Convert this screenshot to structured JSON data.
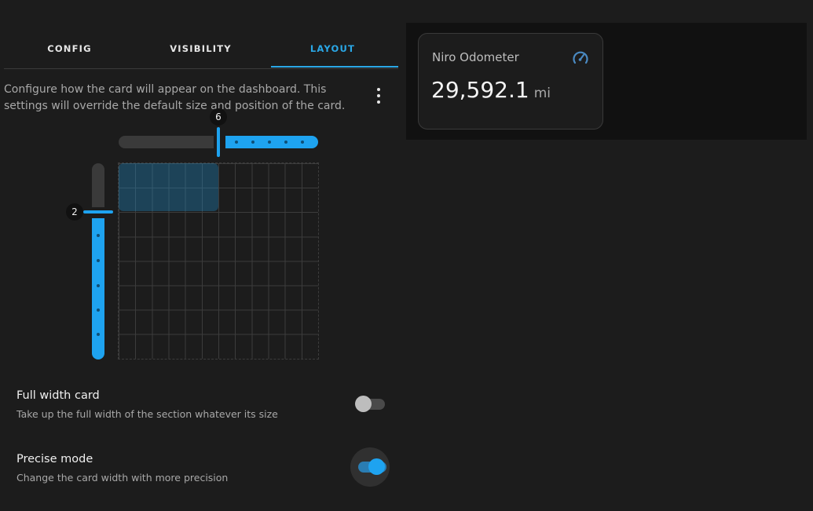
{
  "tabs": [
    {
      "label": "CONFIG",
      "active": false
    },
    {
      "label": "VISIBILITY",
      "active": false
    },
    {
      "label": "LAYOUT",
      "active": true
    }
  ],
  "description": "Configure how the card will appear on the dashboard. This settings will override the default size and position of the card.",
  "icons": {
    "menu": "dots-vertical-icon",
    "card": "speedometer-icon"
  },
  "layout_editor": {
    "columns_value": "6",
    "rows_value": "2",
    "grid_columns": 12,
    "grid_rows": 8
  },
  "options": {
    "full_width": {
      "title": "Full width card",
      "subtitle": "Take up the full width of the section whatever its size",
      "enabled": false
    },
    "precise_mode": {
      "title": "Precise mode",
      "subtitle": "Change the card width with more precision",
      "enabled": true
    }
  },
  "preview_card": {
    "title": "Niro Odometer",
    "value": "29,592.1",
    "unit": "mi"
  },
  "colors": {
    "accent": "#1ea3f0",
    "tab_active": "#2aa7e6",
    "background": "#1c1c1c"
  }
}
